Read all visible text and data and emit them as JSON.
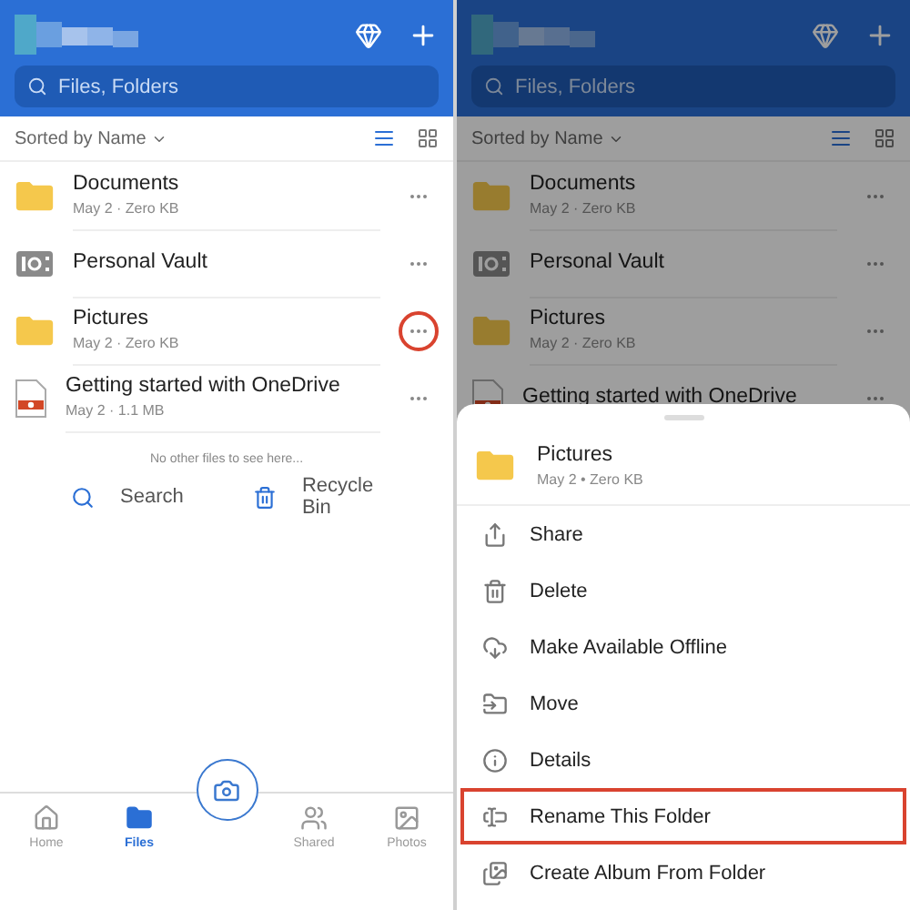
{
  "screens": [
    {
      "search_placeholder": "Files, Folders",
      "sort_label": "Sorted by Name",
      "view_modes": [
        {
          "kind": "list",
          "selected": true
        },
        {
          "kind": "grid",
          "selected": false
        }
      ],
      "files": [
        {
          "kind": "folder",
          "name": "Documents",
          "meta": "May 2 · Zero KB",
          "highlighted": false
        },
        {
          "kind": "vault",
          "name": "Personal Vault",
          "highlighted": false
        },
        {
          "kind": "folder",
          "name": "Pictures",
          "meta": "May 2 · Zero KB",
          "highlighted": true
        },
        {
          "kind": "file",
          "name": "Getting started with OneDrive",
          "meta": "May 2 · 1.1 MB",
          "highlighted": false
        }
      ],
      "empty_note": "No other files to see here...",
      "quick_actions": [
        {
          "kind": "search",
          "label": "Search"
        },
        {
          "kind": "recycle",
          "label": "Recycle Bin"
        }
      ],
      "tabs": [
        {
          "kind": "home",
          "label": "Home",
          "selected": false
        },
        {
          "kind": "files",
          "label": "Files",
          "selected": true
        },
        {
          "kind": "camera",
          "selected": false
        },
        {
          "kind": "shared",
          "label": "Shared",
          "selected": false
        },
        {
          "kind": "photos",
          "label": "Photos",
          "selected": false
        }
      ]
    },
    {
      "dimmed": true,
      "search_placeholder": "Files, Folders",
      "sort_label": "Sorted by Name",
      "view_modes": [
        {
          "kind": "list",
          "selected": true
        },
        {
          "kind": "grid",
          "selected": false
        }
      ],
      "files": [
        {
          "kind": "folder",
          "name": "Documents",
          "meta": "May 2 · Zero KB",
          "highlighted": false
        },
        {
          "kind": "vault",
          "name": "Personal Vault",
          "highlighted": false
        },
        {
          "kind": "folder",
          "name": "Pictures",
          "meta": "May 2 · Zero KB",
          "highlighted": false
        },
        {
          "kind": "file",
          "name": "Getting started with OneDrive",
          "highlighted": false
        }
      ],
      "sheet": {
        "item": {
          "kind": "folder",
          "name": "Pictures",
          "meta": "May 2 • Zero KB"
        },
        "actions": [
          {
            "kind": "share",
            "label": "Share",
            "highlighted": false
          },
          {
            "kind": "delete",
            "label": "Delete",
            "highlighted": false
          },
          {
            "kind": "offline",
            "label": "Make Available Offline",
            "highlighted": false
          },
          {
            "kind": "move",
            "label": "Move",
            "highlighted": false
          },
          {
            "kind": "details",
            "label": "Details",
            "highlighted": false
          },
          {
            "kind": "rename",
            "label": "Rename This Folder",
            "highlighted": true
          },
          {
            "kind": "album",
            "label": "Create Album From Folder",
            "highlighted": false
          }
        ]
      }
    }
  ]
}
